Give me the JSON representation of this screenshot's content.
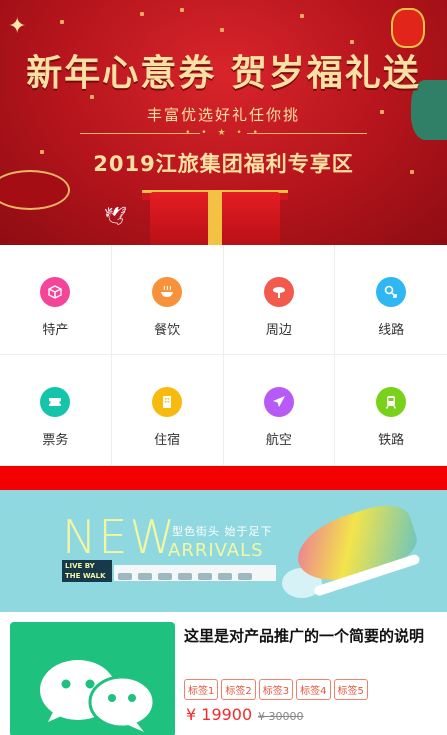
{
  "banner": {
    "title": "新年心意券 贺岁福礼送",
    "subtitle": "丰富优选好礼任你挑",
    "zone": "2019江旅集团福利专享区",
    "dots": "• • ★ • •"
  },
  "categories": [
    {
      "label": "特产",
      "icon": "box-icon",
      "color": "#f5459a"
    },
    {
      "label": "餐饮",
      "icon": "bowl-icon",
      "color": "#f7923a"
    },
    {
      "label": "周边",
      "icon": "scenic-icon",
      "color": "#f25a4d"
    },
    {
      "label": "线路",
      "icon": "route-icon",
      "color": "#2fb7f3"
    },
    {
      "label": "票务",
      "icon": "ticket-icon",
      "color": "#15c5ab"
    },
    {
      "label": "住宿",
      "icon": "hotel-icon",
      "color": "#f7bb0f"
    },
    {
      "label": "航空",
      "icon": "plane-icon",
      "color": "#b85af5"
    },
    {
      "label": "铁路",
      "icon": "train-icon",
      "color": "#7ad11a"
    }
  ],
  "promo": {
    "new_text": "NEW",
    "arrivals_text": "ARRIVALS",
    "tagline": "型色街头 始于足下",
    "walk_text": "LIVE BY THE WALK"
  },
  "product": {
    "title": "这里是对产品推广的一个简要的说明",
    "tags": [
      "标签1",
      "标签2",
      "标签3",
      "标签4",
      "标签5"
    ],
    "price": "¥ 19900",
    "original_price": "¥ 30000",
    "thumb_icon": "wechat-icon"
  }
}
